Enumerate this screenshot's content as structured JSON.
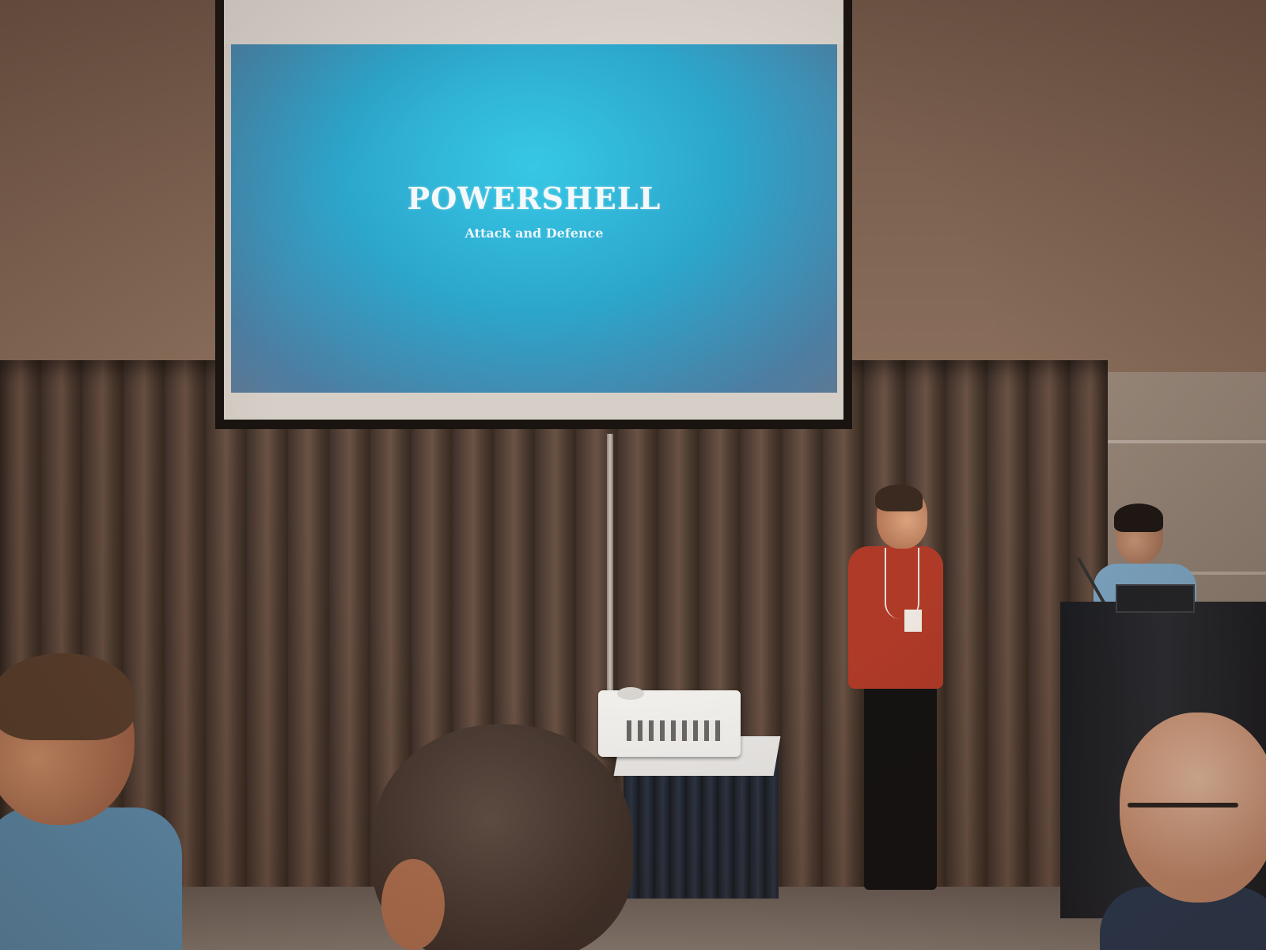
{
  "slide": {
    "title": "POWERSHELL",
    "subtitle": "Attack and Defence"
  },
  "colors": {
    "slide_background": "#2ca6cc",
    "slide_text": "#f4f8fa",
    "curtain": "#4a392f",
    "wall": "#7c6150",
    "presenter_shirt": "#b03a28"
  }
}
